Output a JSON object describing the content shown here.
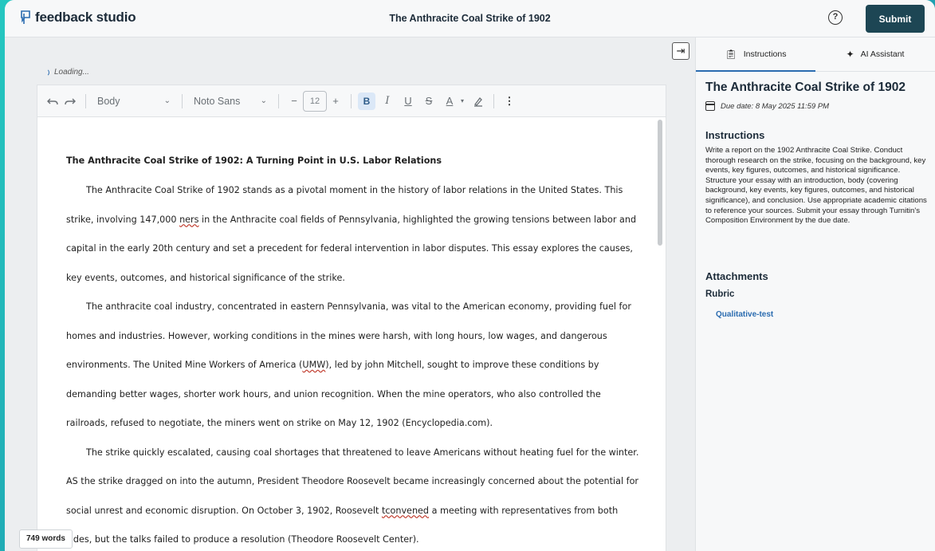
{
  "header": {
    "app_name": "feedback studio",
    "document_title": "The Anthracite Coal Strike of 1902",
    "help_label": "?",
    "submit_label": "Submit"
  },
  "loading_text": "Loading...",
  "toolbar": {
    "undo_icon": "undo-icon",
    "redo_icon": "redo-icon",
    "style_value": "Body",
    "font_value": "Noto Sans",
    "font_size": "12",
    "decrease_label": "−",
    "increase_label": "+",
    "bold_label": "B",
    "italic_label": "I",
    "underline_label": "U",
    "strike_label": "S",
    "color_label": "A",
    "more_label": "⋮"
  },
  "document": {
    "heading": "The Anthracite Coal Strike of 1902: A Turning Point in U.S. Labor Relations",
    "p1_a": "The Anthracite Coal Strike of 1902 stands as a pivotal moment in the history of labor relations in the United States. This strike, involving 147,000 ",
    "p1_err": "ners",
    "p1_b": " in the Anthracite coal fields of Pennsylvania, highlighted the growing tensions between labor and capital in the early 20th century and set a precedent for federal intervention in labor disputes. This essay explores the causes, key events, outcomes, and historical significance of the strike.",
    "p2_a": "The anthracite coal industry, concentrated in eastern Pennsylvania, was vital to the American economy, providing fuel for homes and industries. However, working conditions in the mines were harsh, with long hours, low wages, and dangerous environments. The United Mine Workers of America (",
    "p2_err": "UMW",
    "p2_b": "), led by john Mitchell, sought to improve these conditions by demanding better wages, shorter work hours, and union recognition. When the mine operators, who also controlled the railroads, refused to negotiate, the miners went on strike on May 12, 1902 (Encyclopedia.com).",
    "p3_a": "The strike quickly escalated, causing coal shortages that threatened to leave Americans without heating fuel for the winter. AS the strike dragged on into the autumn, President Theodore Roosevelt became increasingly concerned about the potential for social unrest and economic disruption. On October 3, 1902, Roosevelt ",
    "p3_err": "tconvened",
    "p3_b": " a meeting with representatives from both sides, but the talks failed to produce a resolution (Theodore Roosevelt Center)."
  },
  "word_count": "749 words",
  "panel": {
    "tab_instructions": "Instructions",
    "tab_ai": "AI Assistant",
    "title": "The Anthracite Coal Strike of 1902",
    "due_date": "Due date: 8 May 2025 11:59 PM",
    "instructions_heading": "Instructions",
    "instructions_text": "Write a report on the 1902 Anthracite Coal Strike. Conduct thorough research on the strike, focusing on the background, key events, key figures, outcomes, and historical significance. Structure your essay with an introduction, body (covering background, key events, key figures, outcomes, and historical significance), and conclusion. Use appropriate academic citations to reference your sources. Submit your essay through Turnitin's Composition Environment by the due date.",
    "attachments_heading": "Attachments",
    "rubric_label": "Rubric",
    "rubric_link": "Qualitative-test"
  },
  "colors": {
    "submit_bg": "#1d4654",
    "link": "#2b6cb0",
    "spellcheck": "#c0392b"
  }
}
